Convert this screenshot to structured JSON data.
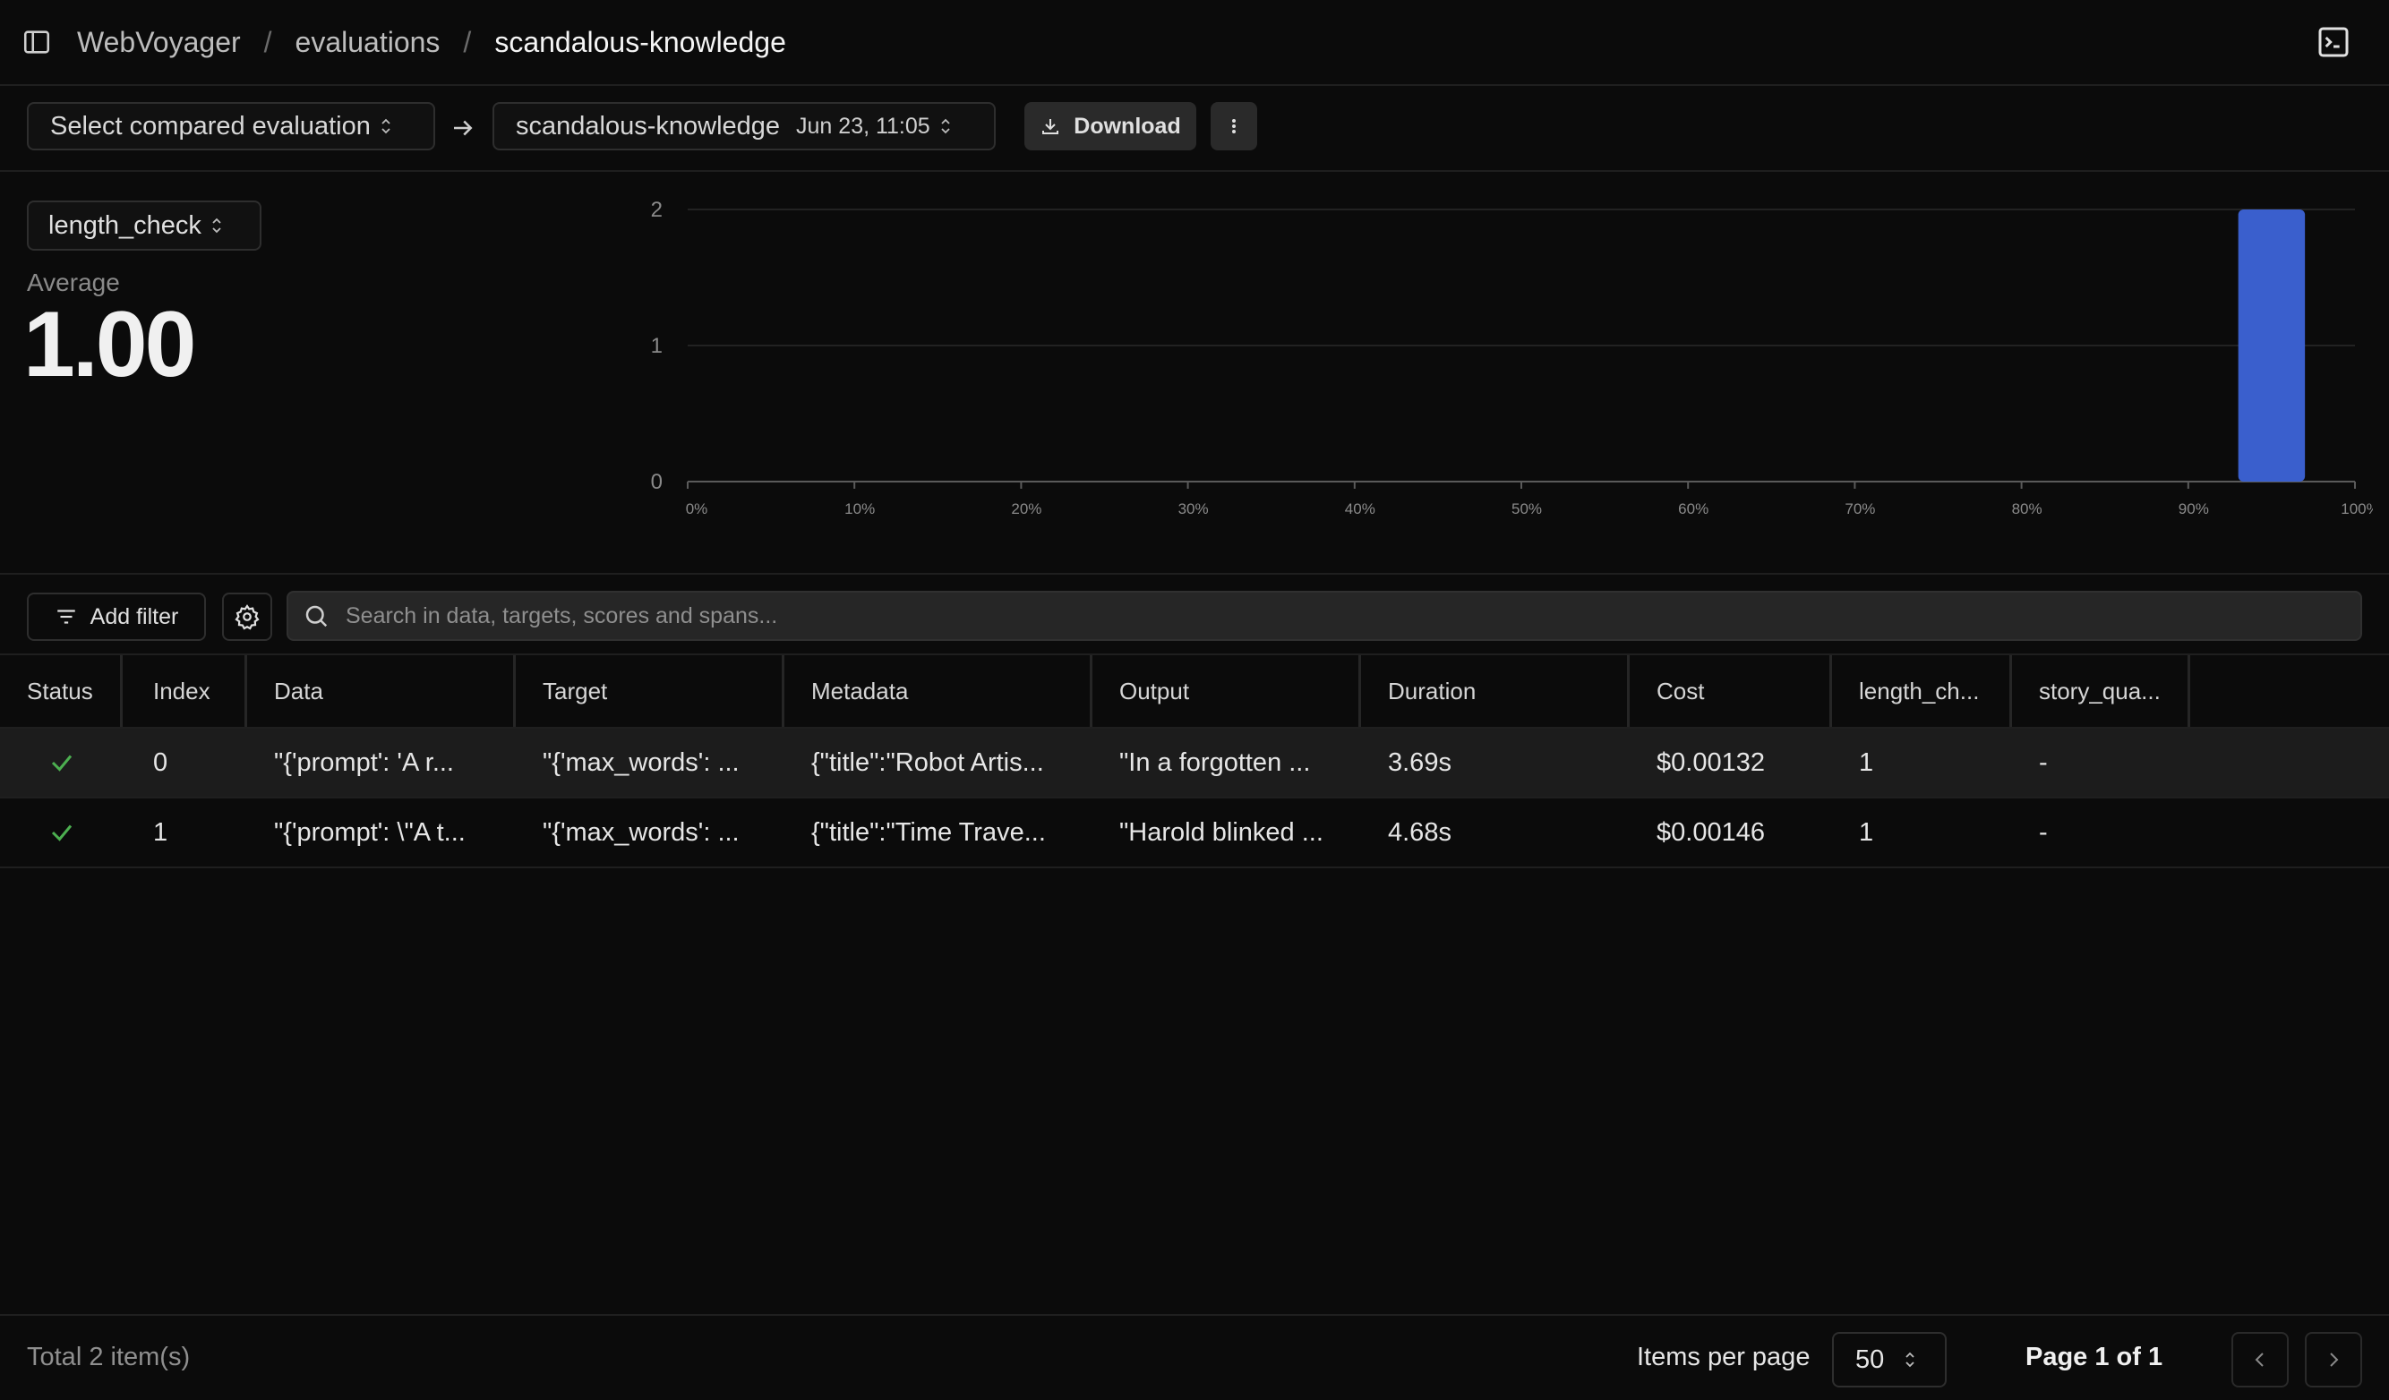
{
  "breadcrumb": [
    "WebVoyager",
    "evaluations",
    "scandalous-knowledge"
  ],
  "toolbar": {
    "compare_placeholder": "Select compared evaluation",
    "run_name": "scandalous-knowledge",
    "run_date": "Jun 23, 11:05",
    "download_label": "Download"
  },
  "summary": {
    "score_name": "length_check",
    "average_label": "Average",
    "average_value": "1.00"
  },
  "chart_data": {
    "type": "bar",
    "categories": [
      "90%-100%"
    ],
    "bins": [
      {
        "from": 93,
        "to": 97,
        "count": 2
      }
    ],
    "values": [
      2
    ],
    "x_ticks": [
      "0%",
      "10%",
      "20%",
      "30%",
      "40%",
      "50%",
      "60%",
      "70%",
      "80%",
      "90%",
      "100%"
    ],
    "y_ticks": [
      "0",
      "1",
      "2"
    ],
    "xlim": [
      0,
      100
    ],
    "ylim": [
      0,
      2
    ],
    "grid": true,
    "bar_color": "#3a5fcd"
  },
  "filters": {
    "add_filter_label": "Add filter",
    "search_placeholder": "Search in data, targets, scores and spans..."
  },
  "table": {
    "columns": [
      "Status",
      "Index",
      "Data",
      "Target",
      "Metadata",
      "Output",
      "Duration",
      "Cost",
      "length_ch...",
      "story_qua..."
    ],
    "rows": [
      {
        "index": "0",
        "data": "\"{'prompt': 'A r...",
        "target": "\"{'max_words': ...",
        "metadata": "{\"title\":\"Robot Artis...",
        "output": "\"In a forgotten ...",
        "duration": "3.69s",
        "cost": "$0.00132",
        "length_check": "1",
        "story_quality": "-"
      },
      {
        "index": "1",
        "data": "\"{'prompt': \\\"A t...",
        "target": "\"{'max_words': ...",
        "metadata": "{\"title\":\"Time Trave...",
        "output": "\"Harold blinked ...",
        "duration": "4.68s",
        "cost": "$0.00146",
        "length_check": "1",
        "story_quality": "-"
      }
    ]
  },
  "footer": {
    "total": "Total 2 item(s)",
    "items_per_page_label": "Items per page",
    "items_per_page": "50",
    "page_info": "Page 1 of 1"
  },
  "colors": {
    "success": "#4caf50",
    "bar": "#3a5fcd",
    "background": "#0b0b0b"
  }
}
